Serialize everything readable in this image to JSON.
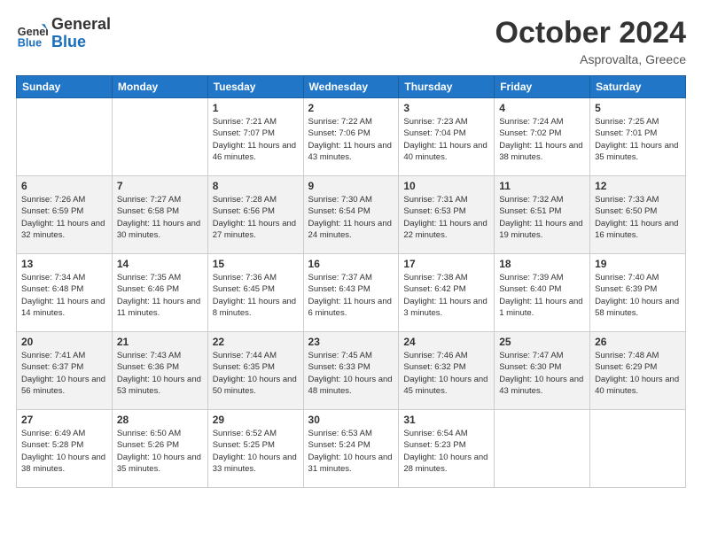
{
  "header": {
    "logo": {
      "general": "General",
      "blue": "Blue"
    },
    "title": "October 2024",
    "location": "Asprovalta, Greece"
  },
  "days_of_week": [
    "Sunday",
    "Monday",
    "Tuesday",
    "Wednesday",
    "Thursday",
    "Friday",
    "Saturday"
  ],
  "weeks": [
    [
      {
        "day": "",
        "info": ""
      },
      {
        "day": "",
        "info": ""
      },
      {
        "day": "1",
        "sunrise": "Sunrise: 7:21 AM",
        "sunset": "Sunset: 7:07 PM",
        "daylight": "Daylight: 11 hours and 46 minutes."
      },
      {
        "day": "2",
        "sunrise": "Sunrise: 7:22 AM",
        "sunset": "Sunset: 7:06 PM",
        "daylight": "Daylight: 11 hours and 43 minutes."
      },
      {
        "day": "3",
        "sunrise": "Sunrise: 7:23 AM",
        "sunset": "Sunset: 7:04 PM",
        "daylight": "Daylight: 11 hours and 40 minutes."
      },
      {
        "day": "4",
        "sunrise": "Sunrise: 7:24 AM",
        "sunset": "Sunset: 7:02 PM",
        "daylight": "Daylight: 11 hours and 38 minutes."
      },
      {
        "day": "5",
        "sunrise": "Sunrise: 7:25 AM",
        "sunset": "Sunset: 7:01 PM",
        "daylight": "Daylight: 11 hours and 35 minutes."
      }
    ],
    [
      {
        "day": "6",
        "sunrise": "Sunrise: 7:26 AM",
        "sunset": "Sunset: 6:59 PM",
        "daylight": "Daylight: 11 hours and 32 minutes."
      },
      {
        "day": "7",
        "sunrise": "Sunrise: 7:27 AM",
        "sunset": "Sunset: 6:58 PM",
        "daylight": "Daylight: 11 hours and 30 minutes."
      },
      {
        "day": "8",
        "sunrise": "Sunrise: 7:28 AM",
        "sunset": "Sunset: 6:56 PM",
        "daylight": "Daylight: 11 hours and 27 minutes."
      },
      {
        "day": "9",
        "sunrise": "Sunrise: 7:30 AM",
        "sunset": "Sunset: 6:54 PM",
        "daylight": "Daylight: 11 hours and 24 minutes."
      },
      {
        "day": "10",
        "sunrise": "Sunrise: 7:31 AM",
        "sunset": "Sunset: 6:53 PM",
        "daylight": "Daylight: 11 hours and 22 minutes."
      },
      {
        "day": "11",
        "sunrise": "Sunrise: 7:32 AM",
        "sunset": "Sunset: 6:51 PM",
        "daylight": "Daylight: 11 hours and 19 minutes."
      },
      {
        "day": "12",
        "sunrise": "Sunrise: 7:33 AM",
        "sunset": "Sunset: 6:50 PM",
        "daylight": "Daylight: 11 hours and 16 minutes."
      }
    ],
    [
      {
        "day": "13",
        "sunrise": "Sunrise: 7:34 AM",
        "sunset": "Sunset: 6:48 PM",
        "daylight": "Daylight: 11 hours and 14 minutes."
      },
      {
        "day": "14",
        "sunrise": "Sunrise: 7:35 AM",
        "sunset": "Sunset: 6:46 PM",
        "daylight": "Daylight: 11 hours and 11 minutes."
      },
      {
        "day": "15",
        "sunrise": "Sunrise: 7:36 AM",
        "sunset": "Sunset: 6:45 PM",
        "daylight": "Daylight: 11 hours and 8 minutes."
      },
      {
        "day": "16",
        "sunrise": "Sunrise: 7:37 AM",
        "sunset": "Sunset: 6:43 PM",
        "daylight": "Daylight: 11 hours and 6 minutes."
      },
      {
        "day": "17",
        "sunrise": "Sunrise: 7:38 AM",
        "sunset": "Sunset: 6:42 PM",
        "daylight": "Daylight: 11 hours and 3 minutes."
      },
      {
        "day": "18",
        "sunrise": "Sunrise: 7:39 AM",
        "sunset": "Sunset: 6:40 PM",
        "daylight": "Daylight: 11 hours and 1 minute."
      },
      {
        "day": "19",
        "sunrise": "Sunrise: 7:40 AM",
        "sunset": "Sunset: 6:39 PM",
        "daylight": "Daylight: 10 hours and 58 minutes."
      }
    ],
    [
      {
        "day": "20",
        "sunrise": "Sunrise: 7:41 AM",
        "sunset": "Sunset: 6:37 PM",
        "daylight": "Daylight: 10 hours and 56 minutes."
      },
      {
        "day": "21",
        "sunrise": "Sunrise: 7:43 AM",
        "sunset": "Sunset: 6:36 PM",
        "daylight": "Daylight: 10 hours and 53 minutes."
      },
      {
        "day": "22",
        "sunrise": "Sunrise: 7:44 AM",
        "sunset": "Sunset: 6:35 PM",
        "daylight": "Daylight: 10 hours and 50 minutes."
      },
      {
        "day": "23",
        "sunrise": "Sunrise: 7:45 AM",
        "sunset": "Sunset: 6:33 PM",
        "daylight": "Daylight: 10 hours and 48 minutes."
      },
      {
        "day": "24",
        "sunrise": "Sunrise: 7:46 AM",
        "sunset": "Sunset: 6:32 PM",
        "daylight": "Daylight: 10 hours and 45 minutes."
      },
      {
        "day": "25",
        "sunrise": "Sunrise: 7:47 AM",
        "sunset": "Sunset: 6:30 PM",
        "daylight": "Daylight: 10 hours and 43 minutes."
      },
      {
        "day": "26",
        "sunrise": "Sunrise: 7:48 AM",
        "sunset": "Sunset: 6:29 PM",
        "daylight": "Daylight: 10 hours and 40 minutes."
      }
    ],
    [
      {
        "day": "27",
        "sunrise": "Sunrise: 6:49 AM",
        "sunset": "Sunset: 5:28 PM",
        "daylight": "Daylight: 10 hours and 38 minutes."
      },
      {
        "day": "28",
        "sunrise": "Sunrise: 6:50 AM",
        "sunset": "Sunset: 5:26 PM",
        "daylight": "Daylight: 10 hours and 35 minutes."
      },
      {
        "day": "29",
        "sunrise": "Sunrise: 6:52 AM",
        "sunset": "Sunset: 5:25 PM",
        "daylight": "Daylight: 10 hours and 33 minutes."
      },
      {
        "day": "30",
        "sunrise": "Sunrise: 6:53 AM",
        "sunset": "Sunset: 5:24 PM",
        "daylight": "Daylight: 10 hours and 31 minutes."
      },
      {
        "day": "31",
        "sunrise": "Sunrise: 6:54 AM",
        "sunset": "Sunset: 5:23 PM",
        "daylight": "Daylight: 10 hours and 28 minutes."
      },
      {
        "day": "",
        "info": ""
      },
      {
        "day": "",
        "info": ""
      }
    ]
  ]
}
